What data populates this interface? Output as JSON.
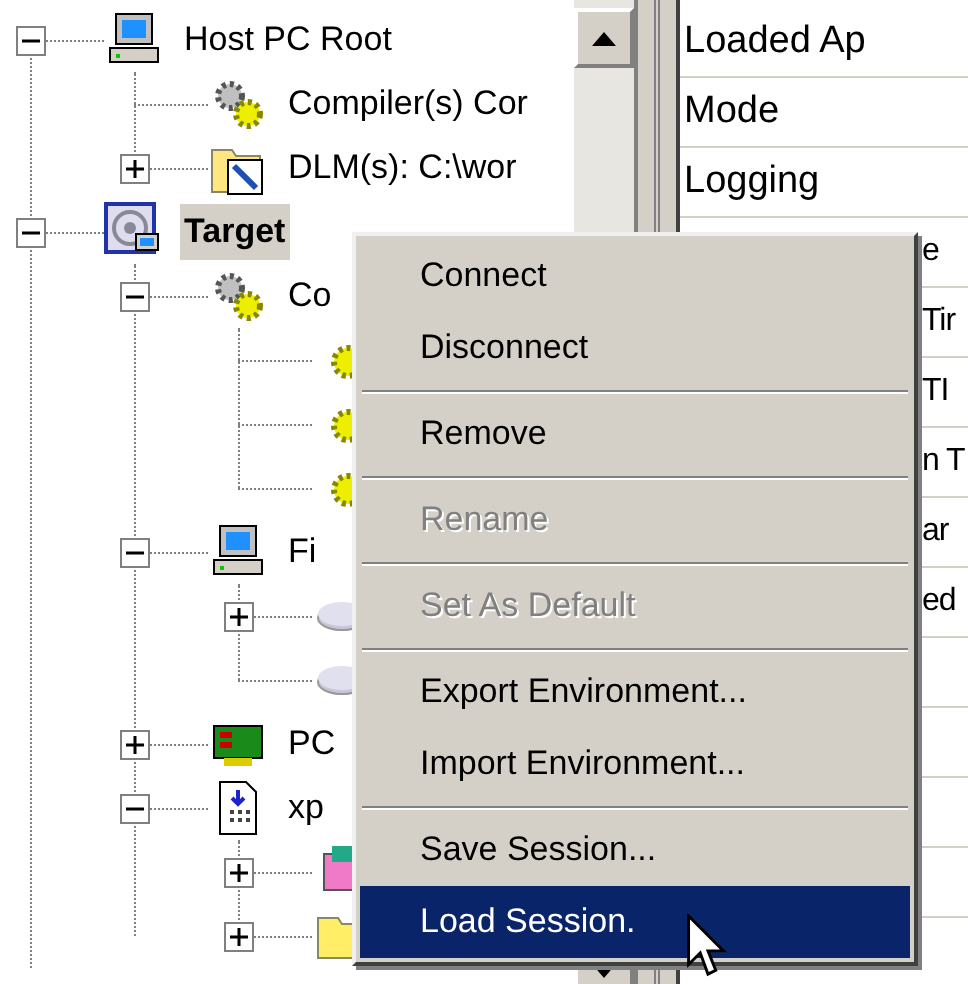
{
  "tree": [
    {
      "label": "Host PC Root",
      "kind": "computer",
      "expanded": true,
      "selected": false,
      "children": [
        {
          "label": "Compiler(s) Cor",
          "kind": "gears",
          "selected": false
        },
        {
          "label": "DLM(s): C:\\wor",
          "kind": "folder-tool",
          "expanded": false,
          "selected": false
        }
      ]
    },
    {
      "label": "Target",
      "kind": "target",
      "expanded": true,
      "selected": true,
      "children": [
        {
          "label": "Co",
          "kind": "gears",
          "expanded": true,
          "selected": false,
          "children": [
            {
              "kind": "gear"
            },
            {
              "kind": "gear"
            },
            {
              "kind": "gear"
            }
          ]
        },
        {
          "label": "Fi",
          "kind": "computer",
          "expanded": true,
          "selected": false,
          "children": [
            {
              "kind": "disk",
              "expanded": false
            },
            {
              "kind": "disk"
            }
          ]
        },
        {
          "label": "PC",
          "kind": "card",
          "expanded": false,
          "selected": false
        },
        {
          "label": "xp",
          "kind": "document",
          "expanded": true,
          "selected": false,
          "children": [
            {
              "kind": "package",
              "expanded": false
            },
            {
              "kind": "folder",
              "expanded": false
            }
          ]
        }
      ]
    }
  ],
  "properties": [
    "Loaded Ap",
    "Mode",
    "Logging",
    "e",
    "Tir",
    "TI",
    "n T",
    "ar",
    "ed"
  ],
  "context_menu": [
    {
      "kind": "item",
      "label": "Connect",
      "disabled": false,
      "selected": false
    },
    {
      "kind": "item",
      "label": "Disconnect",
      "disabled": false,
      "selected": false
    },
    {
      "kind": "separator"
    },
    {
      "kind": "item",
      "label": "Remove",
      "disabled": false,
      "selected": false
    },
    {
      "kind": "separator"
    },
    {
      "kind": "item",
      "label": "Rename",
      "disabled": true,
      "selected": false
    },
    {
      "kind": "separator"
    },
    {
      "kind": "item",
      "label": "Set As Default",
      "disabled": true,
      "selected": false
    },
    {
      "kind": "separator"
    },
    {
      "kind": "item",
      "label": "Export Environment...",
      "disabled": false,
      "selected": false
    },
    {
      "kind": "item",
      "label": "Import Environment...",
      "disabled": false,
      "selected": false
    },
    {
      "kind": "separator"
    },
    {
      "kind": "item",
      "label": "Save Session...",
      "disabled": false,
      "selected": false
    },
    {
      "kind": "item",
      "label": "Load Session.",
      "disabled": false,
      "selected": true
    }
  ]
}
